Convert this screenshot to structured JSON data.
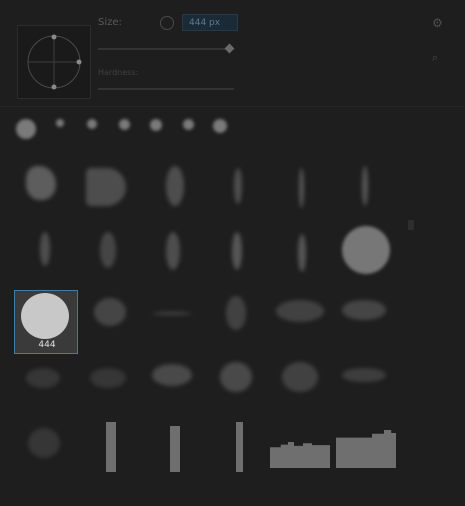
{
  "settings": {
    "size_label": "Size:",
    "size_value": "",
    "size_field_value": "444 px",
    "hardness_label": "Hardness:",
    "hardness_value": "",
    "size_slider_level": 0.98,
    "hardness_slider_level": 1.0
  },
  "toolbar": {
    "gear_icon": "gear-icon",
    "search_icon": "search-icon",
    "reset_icon": "reset-icon"
  },
  "recent_brushes": [
    {
      "label": ""
    },
    {
      "label": ""
    },
    {
      "label": ""
    },
    {
      "label": ""
    },
    {
      "label": ""
    },
    {
      "label": ""
    },
    {
      "label": ""
    }
  ],
  "brushes": [
    {
      "caption": ""
    },
    {
      "caption": ""
    },
    {
      "caption": ""
    },
    {
      "caption": ""
    },
    {
      "caption": ""
    },
    {
      "caption": ""
    },
    {
      "caption": ""
    },
    {
      "caption": ""
    },
    {
      "caption": ""
    },
    {
      "caption": ""
    },
    {
      "caption": ""
    },
    {
      "caption": ""
    },
    {
      "caption": "444"
    },
    {
      "caption": ""
    },
    {
      "caption": ""
    },
    {
      "caption": ""
    },
    {
      "caption": ""
    },
    {
      "caption": ""
    },
    {
      "caption": ""
    },
    {
      "caption": ""
    },
    {
      "caption": ""
    },
    {
      "caption": ""
    },
    {
      "caption": ""
    },
    {
      "caption": ""
    },
    {
      "caption": ""
    },
    {
      "caption": ""
    },
    {
      "caption": ""
    },
    {
      "caption": ""
    },
    {
      "caption": ""
    },
    {
      "caption": ""
    }
  ],
  "colors": {
    "accent": "#3d7ea6",
    "panel_bg": "#1e1e1e",
    "selected_bg": "#3a3a3a",
    "brush_tip": "#c8c8c8"
  }
}
